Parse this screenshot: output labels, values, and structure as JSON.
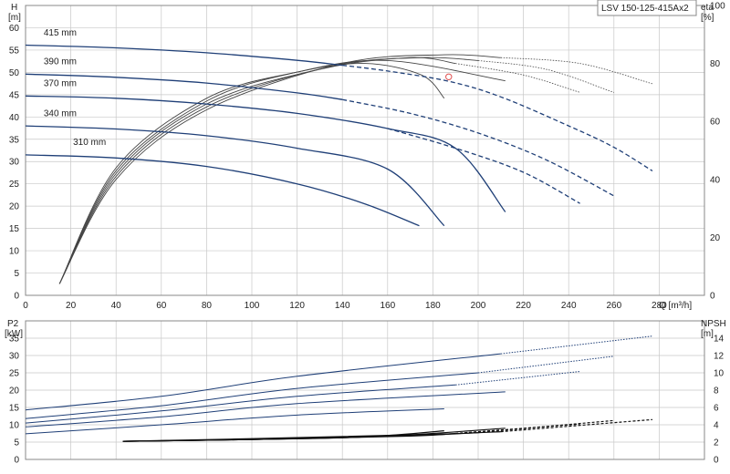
{
  "title": "LSV 150-125-415Ax2",
  "colors": {
    "curve": "#1f3f77",
    "eff": "#444444",
    "npsh": "#111111",
    "grid": "#c8c8c8",
    "marker": "#e05050"
  },
  "chart_data": [
    {
      "type": "line",
      "name": "head",
      "ylabel_left": [
        "H",
        "[m]"
      ],
      "ylabel_right": [
        "eta",
        "[%]"
      ],
      "xlabel": "Q [m³/h]",
      "x_ticks": [
        "0",
        "20",
        "40",
        "60",
        "80",
        "100",
        "120",
        "140",
        "160",
        "180",
        "200",
        "220",
        "240",
        "260",
        "280"
      ],
      "xlim": [
        0,
        300
      ],
      "ylim": [
        0,
        65
      ],
      "y_ticks": [
        "0",
        "5",
        "10",
        "15",
        "20",
        "25",
        "30",
        "35",
        "40",
        "45",
        "50",
        "55",
        "60"
      ],
      "eta_ticks": [
        "0",
        "20",
        "40",
        "60",
        "80",
        "100"
      ],
      "eta_range": [
        0,
        100
      ],
      "grid": true,
      "operating_point": {
        "x": 187,
        "y": 49
      },
      "head_curves": [
        {
          "label": "415 mm",
          "solid": [
            [
              0,
              56.1
            ],
            [
              40,
              55.5
            ],
            [
              80,
              54.4
            ],
            [
              120,
              52.7
            ],
            [
              140,
              51.6
            ]
          ],
          "dashed": [
            [
              140,
              51.6
            ],
            [
              160,
              50.3
            ],
            [
              187,
              48.0
            ],
            [
              210,
              44.5
            ],
            [
              240,
              38.0
            ],
            [
              260,
              33.2
            ],
            [
              277,
              27.9
            ]
          ]
        },
        {
          "label": "390 mm",
          "solid": [
            [
              0,
              49.6
            ],
            [
              40,
              48.9
            ],
            [
              80,
              47.6
            ],
            [
              120,
              45.4
            ],
            [
              140,
              43.9
            ]
          ],
          "dashed": [
            [
              140,
              43.9
            ],
            [
              170,
              40.8
            ],
            [
              200,
              36.4
            ],
            [
              230,
              30.4
            ],
            [
              260,
              22.3
            ]
          ]
        },
        {
          "label": "370 mm",
          "solid": [
            [
              0,
              44.7
            ],
            [
              40,
              44.2
            ],
            [
              80,
              42.9
            ],
            [
              120,
              40.8
            ],
            [
              160,
              37.4
            ],
            [
              190,
              33.0
            ],
            [
              212,
              18.7
            ]
          ],
          "dashed": [
            [
              160,
              37.4
            ],
            [
              190,
              33.0
            ],
            [
              220,
              27.6
            ],
            [
              245,
              20.6
            ]
          ]
        },
        {
          "label": "340 mm",
          "solid": [
            [
              0,
              38.0
            ],
            [
              40,
              37.3
            ],
            [
              80,
              35.8
            ],
            [
              120,
              33.0
            ],
            [
              160,
              28.3
            ],
            [
              185,
              15.6
            ]
          ],
          "dashed": []
        },
        {
          "label": "310 mm",
          "solid": [
            [
              0,
              31.5
            ],
            [
              40,
              30.8
            ],
            [
              80,
              28.9
            ],
            [
              120,
              25.0
            ],
            [
              150,
              20.5
            ],
            [
              174,
              15.6
            ]
          ],
          "dashed": []
        }
      ],
      "efficiency_curves": [
        {
          "solid": [
            [
              15,
              4
            ],
            [
              40,
              44
            ],
            [
              80,
              68
            ],
            [
              120,
              77
            ],
            [
              150,
              80
            ],
            [
              175,
              76
            ],
            [
              185,
              68
            ]
          ],
          "dotted": []
        },
        {
          "solid": [
            [
              15,
              4
            ],
            [
              40,
              43
            ],
            [
              80,
              67
            ],
            [
              120,
              77
            ],
            [
              160,
              81
            ],
            [
              212,
              74
            ]
          ],
          "dotted": []
        },
        {
          "solid": [
            [
              15,
              4
            ],
            [
              40,
              42
            ],
            [
              80,
              66
            ],
            [
              130,
              78
            ],
            [
              170,
              82
            ],
            [
              190,
              80
            ]
          ],
          "dotted": [
            [
              190,
              80
            ],
            [
              220,
              76
            ],
            [
              245,
              70
            ]
          ]
        },
        {
          "solid": [
            [
              15,
              4
            ],
            [
              40,
              41
            ],
            [
              80,
              65
            ],
            [
              135,
              79
            ],
            [
              175,
              82
            ],
            [
              200,
              81
            ]
          ],
          "dotted": [
            [
              200,
              81
            ],
            [
              230,
              78
            ],
            [
              260,
              70
            ]
          ]
        },
        {
          "solid": [
            [
              15,
              4
            ],
            [
              40,
              40
            ],
            [
              80,
              64
            ],
            [
              140,
              80
            ],
            [
              185,
              83
            ],
            [
              210,
              82
            ]
          ],
          "dotted": [
            [
              210,
              82
            ],
            [
              245,
              80
            ],
            [
              277,
              73
            ]
          ]
        }
      ]
    },
    {
      "type": "line",
      "name": "power-npsh",
      "ylabel_left": [
        "P2",
        "[kW]"
      ],
      "ylabel_right": [
        "NPSH",
        "[m]"
      ],
      "xlim": [
        0,
        300
      ],
      "ylim": [
        0,
        40
      ],
      "y_ticks": [
        "0",
        "5",
        "10",
        "15",
        "20",
        "25",
        "30",
        "35"
      ],
      "npsh_ticks": [
        "0",
        "2",
        "4",
        "6",
        "8",
        "10",
        "12",
        "14"
      ],
      "npsh_range": [
        0,
        16
      ],
      "grid": true,
      "power_curves": [
        {
          "solid": [
            [
              0,
              7.4
            ],
            [
              60,
              10.0
            ],
            [
              120,
              12.8
            ],
            [
              185,
              14.6
            ]
          ],
          "dashed": []
        },
        {
          "solid": [
            [
              0,
              9.4
            ],
            [
              60,
              12.3
            ],
            [
              120,
              16.1
            ],
            [
              212,
              19.5
            ]
          ],
          "dashed": []
        },
        {
          "solid": [
            [
              0,
              10.5
            ],
            [
              60,
              14.0
            ],
            [
              120,
              18.2
            ],
            [
              190,
              21.5
            ]
          ],
          "dashed": [
            [
              190,
              21.5
            ],
            [
              245,
              25.4
            ]
          ]
        },
        {
          "solid": [
            [
              0,
              11.8
            ],
            [
              60,
              15.5
            ],
            [
              120,
              20.5
            ],
            [
              200,
              25.0
            ]
          ],
          "dashed": [
            [
              200,
              25.0
            ],
            [
              260,
              29.8
            ]
          ]
        },
        {
          "solid": [
            [
              0,
              14.3
            ],
            [
              60,
              18.2
            ],
            [
              120,
              24.0
            ],
            [
              210,
              30.5
            ]
          ],
          "dashed": [
            [
              210,
              30.5
            ],
            [
              277,
              35.6
            ]
          ]
        }
      ],
      "npsh_curves": [
        {
          "solid": [
            [
              43,
              2.1
            ],
            [
              100,
              2.3
            ],
            [
              150,
              2.6
            ],
            [
              185,
              3.3
            ]
          ],
          "dashed": []
        },
        {
          "solid": [
            [
              43,
              2.1
            ],
            [
              100,
              2.3
            ],
            [
              160,
              2.7
            ],
            [
              212,
              3.6
            ]
          ],
          "dashed": []
        },
        {
          "solid": [
            [
              43,
              2.1
            ],
            [
              100,
              2.3
            ],
            [
              170,
              2.7
            ],
            [
              190,
              3.0
            ]
          ],
          "dashed": [
            [
              190,
              3.0
            ],
            [
              245,
              4.1
            ]
          ]
        },
        {
          "solid": [
            [
              43,
              2.1
            ],
            [
              100,
              2.3
            ],
            [
              175,
              2.8
            ],
            [
              200,
              3.1
            ]
          ],
          "dashed": [
            [
              200,
              3.1
            ],
            [
              260,
              4.5
            ]
          ]
        },
        {
          "solid": [
            [
              43,
              2.1
            ],
            [
              100,
              2.4
            ],
            [
              180,
              2.9
            ],
            [
              210,
              3.2
            ]
          ],
          "dashed": [
            [
              210,
              3.2
            ],
            [
              277,
              4.6
            ]
          ]
        }
      ]
    }
  ]
}
